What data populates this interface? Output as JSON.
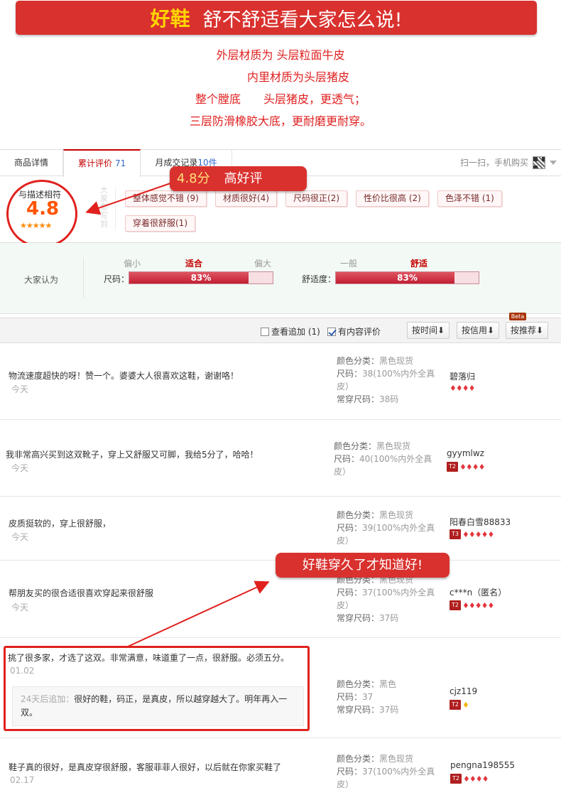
{
  "banner": {
    "highlight": "好鞋",
    "rest": "舒不舒适看大家怎么说!"
  },
  "features": [
    "外层材质为 头层粒面牛皮",
    "内里材质为头层猪皮",
    "整个膛底　　头层猪皮，更透气；",
    "三层防滑橡胶大底，更耐磨更耐穿。"
  ],
  "tabs": [
    {
      "label": "商品详情",
      "count": ""
    },
    {
      "label": "累计评价",
      "count": "71"
    },
    {
      "label": "月成交记录",
      "count": "10件"
    }
  ],
  "scan_text": "扫一扫，手机购买",
  "score": {
    "label": "与描述相符",
    "value": "4.8",
    "stars": "★★★★★"
  },
  "vertical_text": "大家都写到",
  "tags": [
    "整体感觉不错 (9)",
    "材质很好(4)",
    "尺码很正(2)",
    "性价比很高 (2)",
    "色泽不错 (1)",
    "穿着很舒服(1)"
  ],
  "callout1": {
    "score": "4.8分",
    "text": "高好评"
  },
  "callout2": "好鞋穿久了才知道好!",
  "opinion": {
    "title": "大家认为",
    "size": {
      "label": "尺码：",
      "left": "偏小",
      "mid": "适合",
      "right": "偏大",
      "pct_text": "83%",
      "pct": 0.83
    },
    "comfort": {
      "label": "舒适度：",
      "left": "一般",
      "mid": "舒适",
      "pct_text": "83%",
      "pct": 0.83
    }
  },
  "filter": {
    "view_followup": "查看追加 (1)",
    "has_content": "有内容评价",
    "sort_time": "按时间",
    "sort_credit": "按信用",
    "sort_recommend": "按推荐",
    "beta": "Beta"
  },
  "meta_keys": {
    "color": "颜色分类：",
    "size": "尺码：",
    "usual": "常穿尺码："
  },
  "reviews": [
    {
      "text": "物流速度超快的呀！赞一个。婆婆大人很喜欢这鞋，谢谢咯！",
      "date": "今天",
      "color": "黑色现货",
      "size": "38(100%内外全真皮）",
      "usual": "38码",
      "user": "碧落归",
      "level": "",
      "gems": "♦♦♦♦",
      "gold": false
    },
    {
      "text": "我非常高兴买到这双靴子，穿上又舒服又可脚，我给5分了，哈哈！",
      "date": "今天",
      "color": "黑色现货",
      "size": "40(100%内外全真皮）",
      "usual": "",
      "user": "gyymlwz",
      "level": "T2",
      "gems": "♦♦♦♦",
      "gold": false
    },
    {
      "text": "皮质挺软的，穿上很舒服，",
      "date": "今天",
      "color": "黑色现货",
      "size": "39(100%内外全真皮）",
      "usual": "",
      "user": "阳春白雪88833",
      "level": "T3",
      "gems": "♦♦♦♦♦",
      "gold": false
    },
    {
      "text": "帮朋友买的很合适很喜欢穿起来很舒服",
      "date": "今天",
      "color": "黑色现货",
      "size": "37(100%内外全真皮）",
      "usual": "37码",
      "user": "c***n（匿名）",
      "level": "T2",
      "gems": "♦♦♦♦♦",
      "gold": false
    },
    {
      "text": "挑了很多家，才选了这双。非常满意，味道重了一点，很舒服。必须五分。",
      "date": "01.02",
      "color": "黑色",
      "size": "37",
      "usual": "37码",
      "user": "cjz119",
      "level": "T2",
      "gems": "♦",
      "gold": true,
      "followup_label": "24天后追加：",
      "followup_text": "很好的鞋，码正，是真皮，所以越穿越大了。明年再入一双。"
    },
    {
      "text": "鞋子真的很好，是真皮穿很舒服，客服菲菲人很好，以后就在你家买鞋了",
      "date": "02.17",
      "color": "黑色现货",
      "size": "37(100%内外全真皮）",
      "usual": "",
      "user": "pengna198555",
      "level": "T2",
      "gems": "♦♦♦♦",
      "gold": false
    }
  ]
}
